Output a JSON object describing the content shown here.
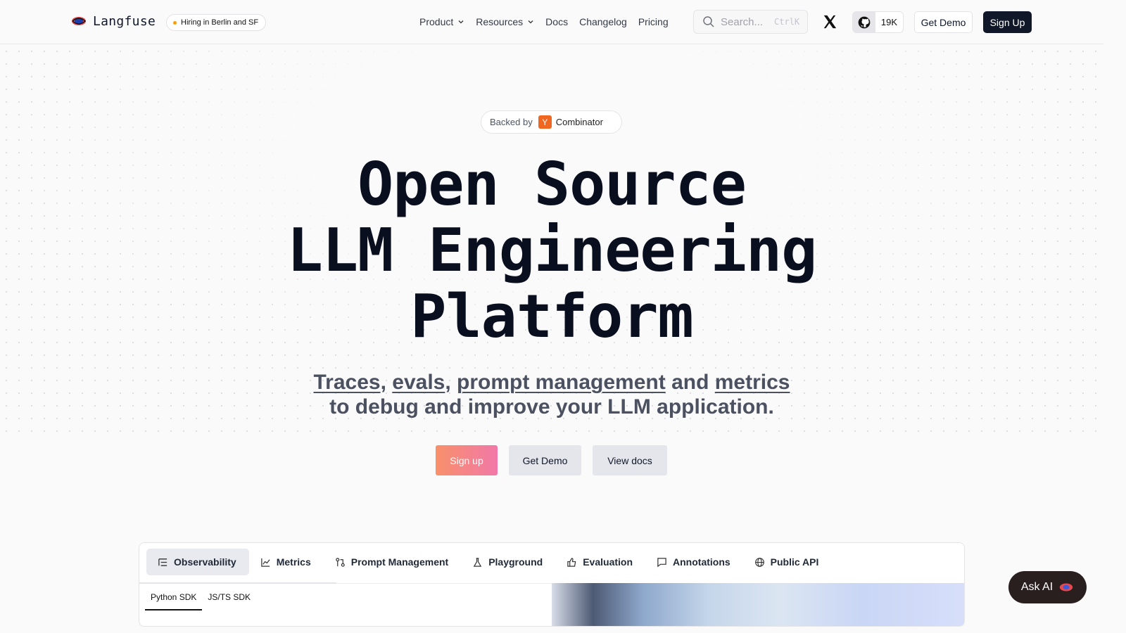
{
  "nav": {
    "brand": "Langfuse",
    "hiring_badge": "Hiring in Berlin and SF",
    "menu": [
      {
        "label": "Product",
        "has_dropdown": true
      },
      {
        "label": "Resources",
        "has_dropdown": true
      },
      {
        "label": "Docs",
        "has_dropdown": false
      },
      {
        "label": "Changelog",
        "has_dropdown": false
      },
      {
        "label": "Pricing",
        "has_dropdown": false
      }
    ],
    "search_placeholder": "Search...",
    "search_shortcut": "CtrlK",
    "github_stars": "19K",
    "get_demo": "Get Demo",
    "sign_up": "Sign Up"
  },
  "hero": {
    "backed_by": "Backed by",
    "yc_letter": "Y",
    "yc_name": "Combinator",
    "title_lines": [
      "Open Source",
      "LLM Engineering",
      "Platform"
    ],
    "subtitle": {
      "links": [
        "Traces",
        "evals",
        "prompt management",
        "metrics"
      ],
      "sep1": ", ",
      "sep2": ", ",
      "and": " and ",
      "line2": "to debug and improve your LLM application."
    },
    "cta": {
      "sign_up": "Sign up",
      "get_demo": "Get Demo",
      "view_docs": "View docs"
    },
    "colors": {
      "cta_gradient_start": "#f8906a",
      "cta_gradient_end": "#f178a8",
      "dark": "#0f1729"
    }
  },
  "demo": {
    "tabs": [
      {
        "label": "Observability",
        "icon": "list-tree-icon",
        "active": true
      },
      {
        "label": "Metrics",
        "icon": "line-chart-icon",
        "active": false
      },
      {
        "label": "Prompt Management",
        "icon": "git-compare-icon",
        "active": false
      },
      {
        "label": "Playground",
        "icon": "flask-icon",
        "active": false
      },
      {
        "label": "Evaluation",
        "icon": "thumbs-up-icon",
        "active": false
      },
      {
        "label": "Annotations",
        "icon": "message-square-icon",
        "active": false
      },
      {
        "label": "Public API",
        "icon": "globe-icon",
        "active": false
      }
    ],
    "sdk_tabs": [
      {
        "label": "Python SDK",
        "active": true
      },
      {
        "label": "JS/TS SDK",
        "active": false
      }
    ]
  },
  "ask_ai": "Ask AI"
}
